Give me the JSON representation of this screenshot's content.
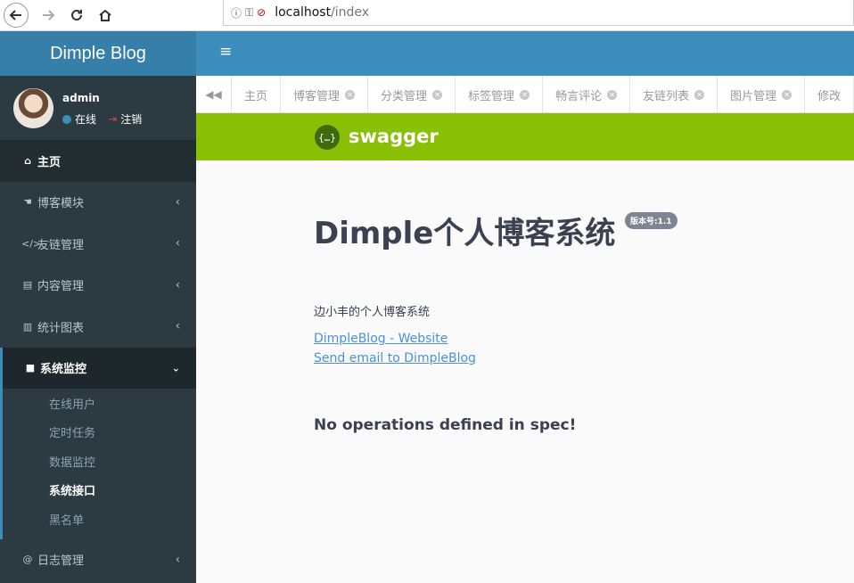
{
  "browser": {
    "url_host": "localhost",
    "url_path": "/index"
  },
  "sidebar": {
    "brand": "Dimple Blog",
    "user": {
      "name": "admin",
      "status": "在线",
      "logout": "注销"
    },
    "items": [
      {
        "label": "主页",
        "icon": "home-icon"
      },
      {
        "label": "博客模块",
        "icon": "hand-icon"
      },
      {
        "label": "友链管理",
        "icon": "code-icon"
      },
      {
        "label": "内容管理",
        "icon": "archive-icon"
      },
      {
        "label": "统计图表",
        "icon": "bar-chart-icon"
      },
      {
        "label": "系统监控",
        "icon": "video-camera-icon"
      },
      {
        "label": "日志管理",
        "icon": "at-icon"
      }
    ],
    "sub_items": [
      "在线用户",
      "定时任务",
      "数据监控",
      "系统接口",
      "黑名单"
    ]
  },
  "tabs": [
    "主页",
    "博客管理",
    "分类管理",
    "标签管理",
    "畅言评论",
    "友链列表",
    "图片管理",
    "修改"
  ],
  "swagger": {
    "logo_text": "{…}",
    "brand": "swagger",
    "title": "Dimple个人博客系统",
    "version": "版本号:1.1",
    "description": "边小丰的个人博客系统",
    "website_link": "DimpleBlog - Website",
    "email_link": "Send email to DimpleBlog",
    "no_operations": "No operations defined in spec!"
  },
  "colors": {
    "sidebar_bg": "#2c3b41",
    "header_bg": "#3c8dbc",
    "brand_bg": "#367fa9",
    "swagger_green": "#89bf04",
    "link": "#4990e2"
  }
}
